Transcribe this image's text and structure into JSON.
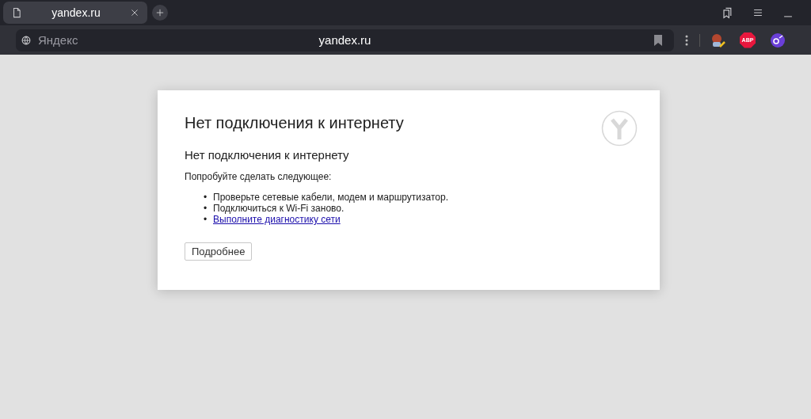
{
  "tab": {
    "title": "yandex.ru",
    "selected": true
  },
  "address_bar": {
    "site_label": "Яндекс",
    "url": "yandex.ru"
  },
  "extensions": [
    {
      "kind": "mascot"
    },
    {
      "kind": "abp",
      "label": "ABP"
    },
    {
      "kind": "purple"
    }
  ],
  "error_page": {
    "title": "Нет подключения к интернету",
    "subtitle": "Нет подключения к интернету",
    "intro": "Попробуйте сделать следующее:",
    "suggestions": [
      {
        "kind": "text",
        "marker": "•",
        "text": "Проверьте сетевые кабели, модем и маршрутизатор."
      },
      {
        "kind": "text",
        "marker": "•",
        "text": "Подключиться к Wi-Fi заново."
      },
      {
        "kind": "link",
        "marker": "•",
        "text": "Выполните диагностику сети"
      }
    ],
    "details_button": "Подробнее"
  }
}
